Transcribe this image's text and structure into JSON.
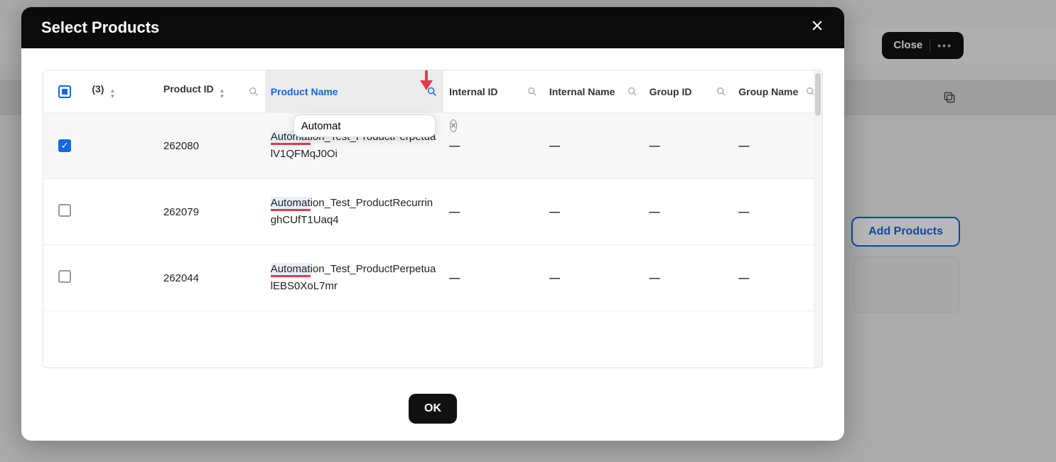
{
  "background": {
    "close_label": "Close",
    "add_products_label": "Add Products"
  },
  "modal": {
    "title": "Select Products",
    "ok_label": "OK",
    "search_value": "Automat",
    "selected_count_label": "(3)",
    "columns": {
      "product_id": "Product ID",
      "product_name": "Product Name",
      "internal_id": "Internal ID",
      "internal_name": "Internal Name",
      "group_id": "Group ID",
      "group_name": "Group Name"
    },
    "rows": [
      {
        "checked": true,
        "product_id": "262080",
        "product_name_prefix": "Automat",
        "product_name_rest": "ion_Test_ProductPerpetualV1QFMqJ0Oi",
        "internal_id": "—",
        "internal_name": "—",
        "group_id": "—",
        "group_name": "—"
      },
      {
        "checked": false,
        "product_id": "262079",
        "product_name_prefix": "Automat",
        "product_name_rest": "ion_Test_ProductRecurringhCUfT1Uaq4",
        "internal_id": "—",
        "internal_name": "—",
        "group_id": "—",
        "group_name": "—"
      },
      {
        "checked": false,
        "product_id": "262044",
        "product_name_prefix": "Automat",
        "product_name_rest": "ion_Test_ProductPerpetualEBS0XoL7mr",
        "internal_id": "—",
        "internal_name": "—",
        "group_id": "—",
        "group_name": "—"
      }
    ]
  }
}
